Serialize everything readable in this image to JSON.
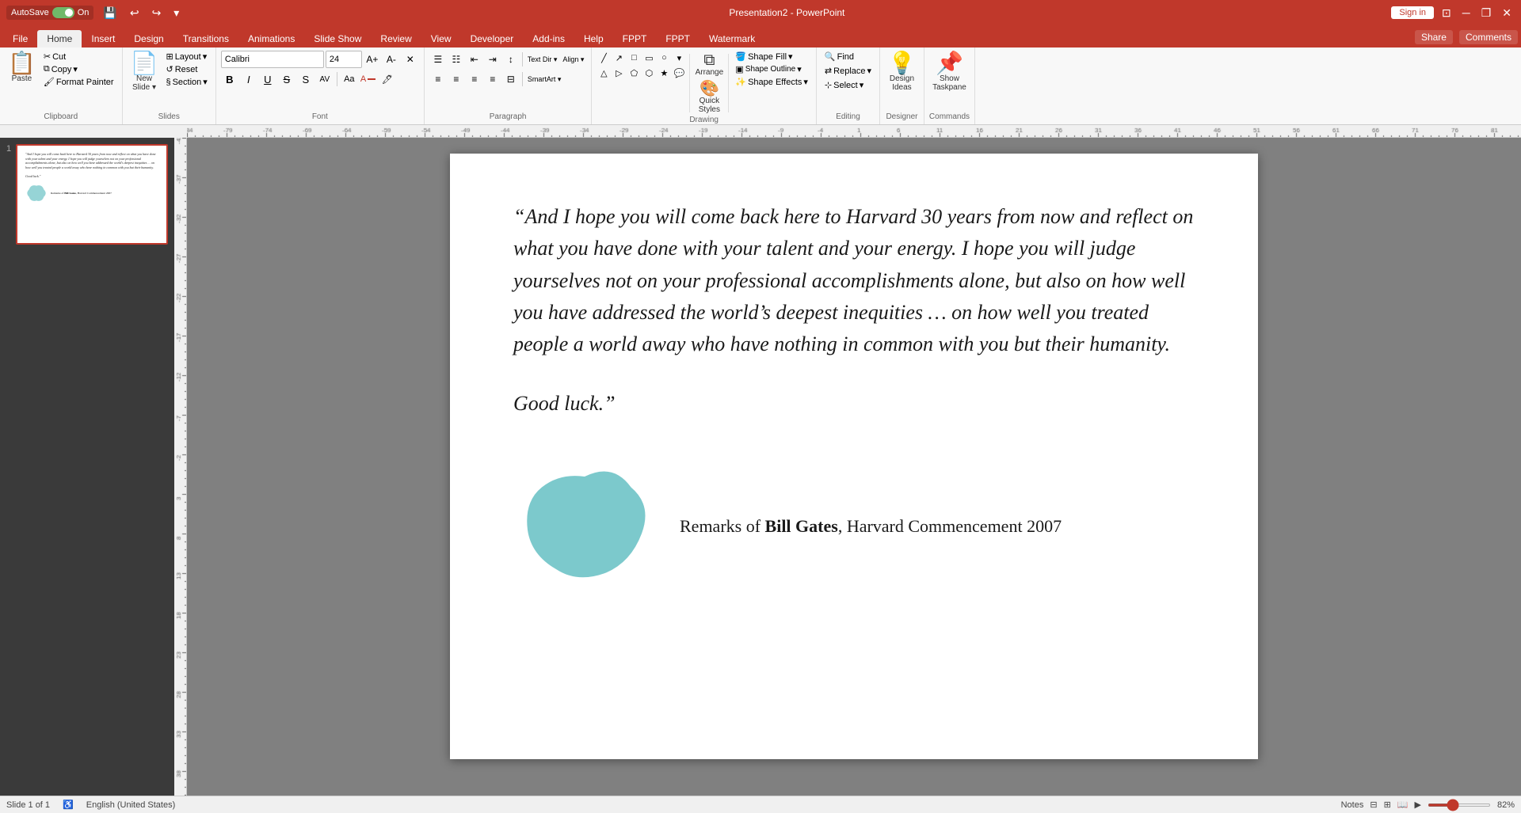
{
  "titlebar": {
    "autosave_label": "AutoSave",
    "autosave_on": "On",
    "title": "Presentation2 - PowerPoint",
    "signin_label": "Sign in",
    "undo_icon": "↩",
    "redo_icon": "↪",
    "save_icon": "💾"
  },
  "tabs": [
    {
      "id": "file",
      "label": "File"
    },
    {
      "id": "home",
      "label": "Home",
      "active": true
    },
    {
      "id": "insert",
      "label": "Insert"
    },
    {
      "id": "design",
      "label": "Design"
    },
    {
      "id": "transitions",
      "label": "Transitions"
    },
    {
      "id": "animations",
      "label": "Animations"
    },
    {
      "id": "slideshow",
      "label": "Slide Show"
    },
    {
      "id": "review",
      "label": "Review"
    },
    {
      "id": "view",
      "label": "View"
    },
    {
      "id": "developer",
      "label": "Developer"
    },
    {
      "id": "addins",
      "label": "Add-ins"
    },
    {
      "id": "help",
      "label": "Help"
    },
    {
      "id": "fppt1",
      "label": "FPPT"
    },
    {
      "id": "fppt2",
      "label": "FPPT"
    },
    {
      "id": "watermark",
      "label": "Watermark"
    }
  ],
  "ribbon": {
    "clipboard": {
      "label": "Clipboard",
      "paste_label": "Paste",
      "cut_label": "Cut",
      "copy_label": "Copy",
      "format_painter_label": "Format Painter"
    },
    "slides": {
      "label": "Slides",
      "new_slide_label": "New\nSlide",
      "layout_label": "Layout",
      "reset_label": "Reset",
      "section_label": "Section"
    },
    "font": {
      "label": "Font",
      "font_name": "Calibri",
      "font_size": "24",
      "bold": "B",
      "italic": "I",
      "underline": "U",
      "strikethrough": "S",
      "shadow": "S",
      "char_spacing": "AV",
      "increase_font": "A↑",
      "decrease_font": "A↓",
      "clear": "✕",
      "font_color": "A",
      "highlight": "🖊"
    },
    "paragraph": {
      "label": "Paragraph",
      "bullets_label": "Bullets",
      "numbering_label": "Numbering",
      "decrease_indent": "⇤",
      "increase_indent": "⇥",
      "line_spacing": "↕",
      "text_direction": "Text Direction",
      "align_text": "Align Text",
      "convert_smartart": "Convert to SmartArt",
      "align_left": "≡",
      "align_center": "≡",
      "align_right": "≡",
      "justify": "≡",
      "columns": "⊟"
    },
    "drawing": {
      "label": "Drawing",
      "arrange_label": "Arrange",
      "quick_styles_label": "Quick\nStyles",
      "shape_fill_label": "Shape Fill",
      "shape_outline_label": "Shape Outline",
      "shape_effects_label": "Shape Effects"
    },
    "editing": {
      "label": "Editing",
      "find_label": "Find",
      "replace_label": "Replace",
      "select_label": "Select"
    },
    "designer": {
      "label": "Designer",
      "design_ideas_label": "Design\nIdeas"
    },
    "commands": {
      "label": "Commands",
      "show_taskpane_label": "Show\nTaskpane"
    }
  },
  "slide": {
    "num": "1",
    "quote": "“And I hope you will come back here to Harvard 30 years from now and reflect on what you have done with your talent and your energy. I hope you will judge yourselves not on your professional accomplishments alone, but also on how well you have addressed the world’s deepest inequities … on how well you treated people a world away who have nothing in common with you but their humanity.",
    "goodluck": "Good luck.”",
    "attribution_prefix": "Remarks of ",
    "attribution_name": "Bill Gates",
    "attribution_suffix": ", Harvard Commencement 2007"
  },
  "statusbar": {
    "slide_info": "Slide 1 of 1",
    "language": "English (United States)",
    "notes_label": "Notes",
    "zoom_percent": "82%"
  },
  "share_label": "Share",
  "comments_label": "Comments"
}
